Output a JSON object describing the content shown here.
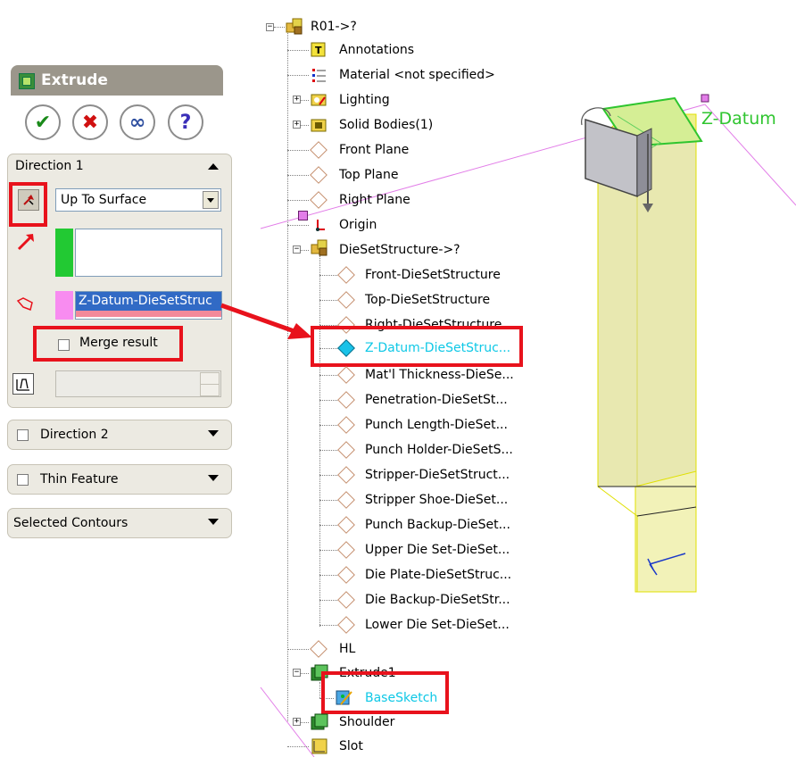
{
  "property_manager": {
    "title": "Extrude",
    "buttons": {
      "ok": "✔",
      "cancel": "✖",
      "preview": "∞",
      "help": "?"
    },
    "direction1": {
      "label": "Direction 1",
      "end_condition": "Up To Surface",
      "face_value": "Z-Datum-DieSetStruc",
      "merge_label": "Merge result"
    },
    "direction2": {
      "label": "Direction 2"
    },
    "thin_feature": {
      "label": "Thin Feature"
    },
    "selected_contours": {
      "label": "Selected Contours"
    }
  },
  "tree": {
    "root": "R01->?",
    "items": [
      "Annotations",
      "Material <not specified>",
      "Lighting",
      "Solid Bodies(1)",
      "Front Plane",
      "Top Plane",
      "Right Plane",
      "Origin",
      "DieSetStructure->?"
    ],
    "subassembly_items": [
      "Front-DieSetStructure",
      "Top-DieSetStructure",
      "Right-DieSetStructure",
      "Z-Datum-DieSetStruc...",
      "Mat'l Thickness-DieSe...",
      "Penetration-DieSetSt...",
      "Punch Length-DieSet...",
      "Punch Holder-DieSetS...",
      "Stripper-DieSetStruct...",
      "Stripper Shoe-DieSet...",
      "Punch Backup-DieSet...",
      "Upper Die Set-DieSet...",
      "Die Plate-DieSetStruc...",
      "Die Backup-DieSetStr...",
      "Lower Die Set-DieSet..."
    ],
    "tail_items": [
      "HL",
      "Extrude1",
      "BaseSketch",
      "Shoulder",
      "Slot"
    ]
  },
  "viewport": {
    "datum_label": "Z-Datum",
    "accent": "#5ccf5c",
    "callout": "#e8121c"
  }
}
